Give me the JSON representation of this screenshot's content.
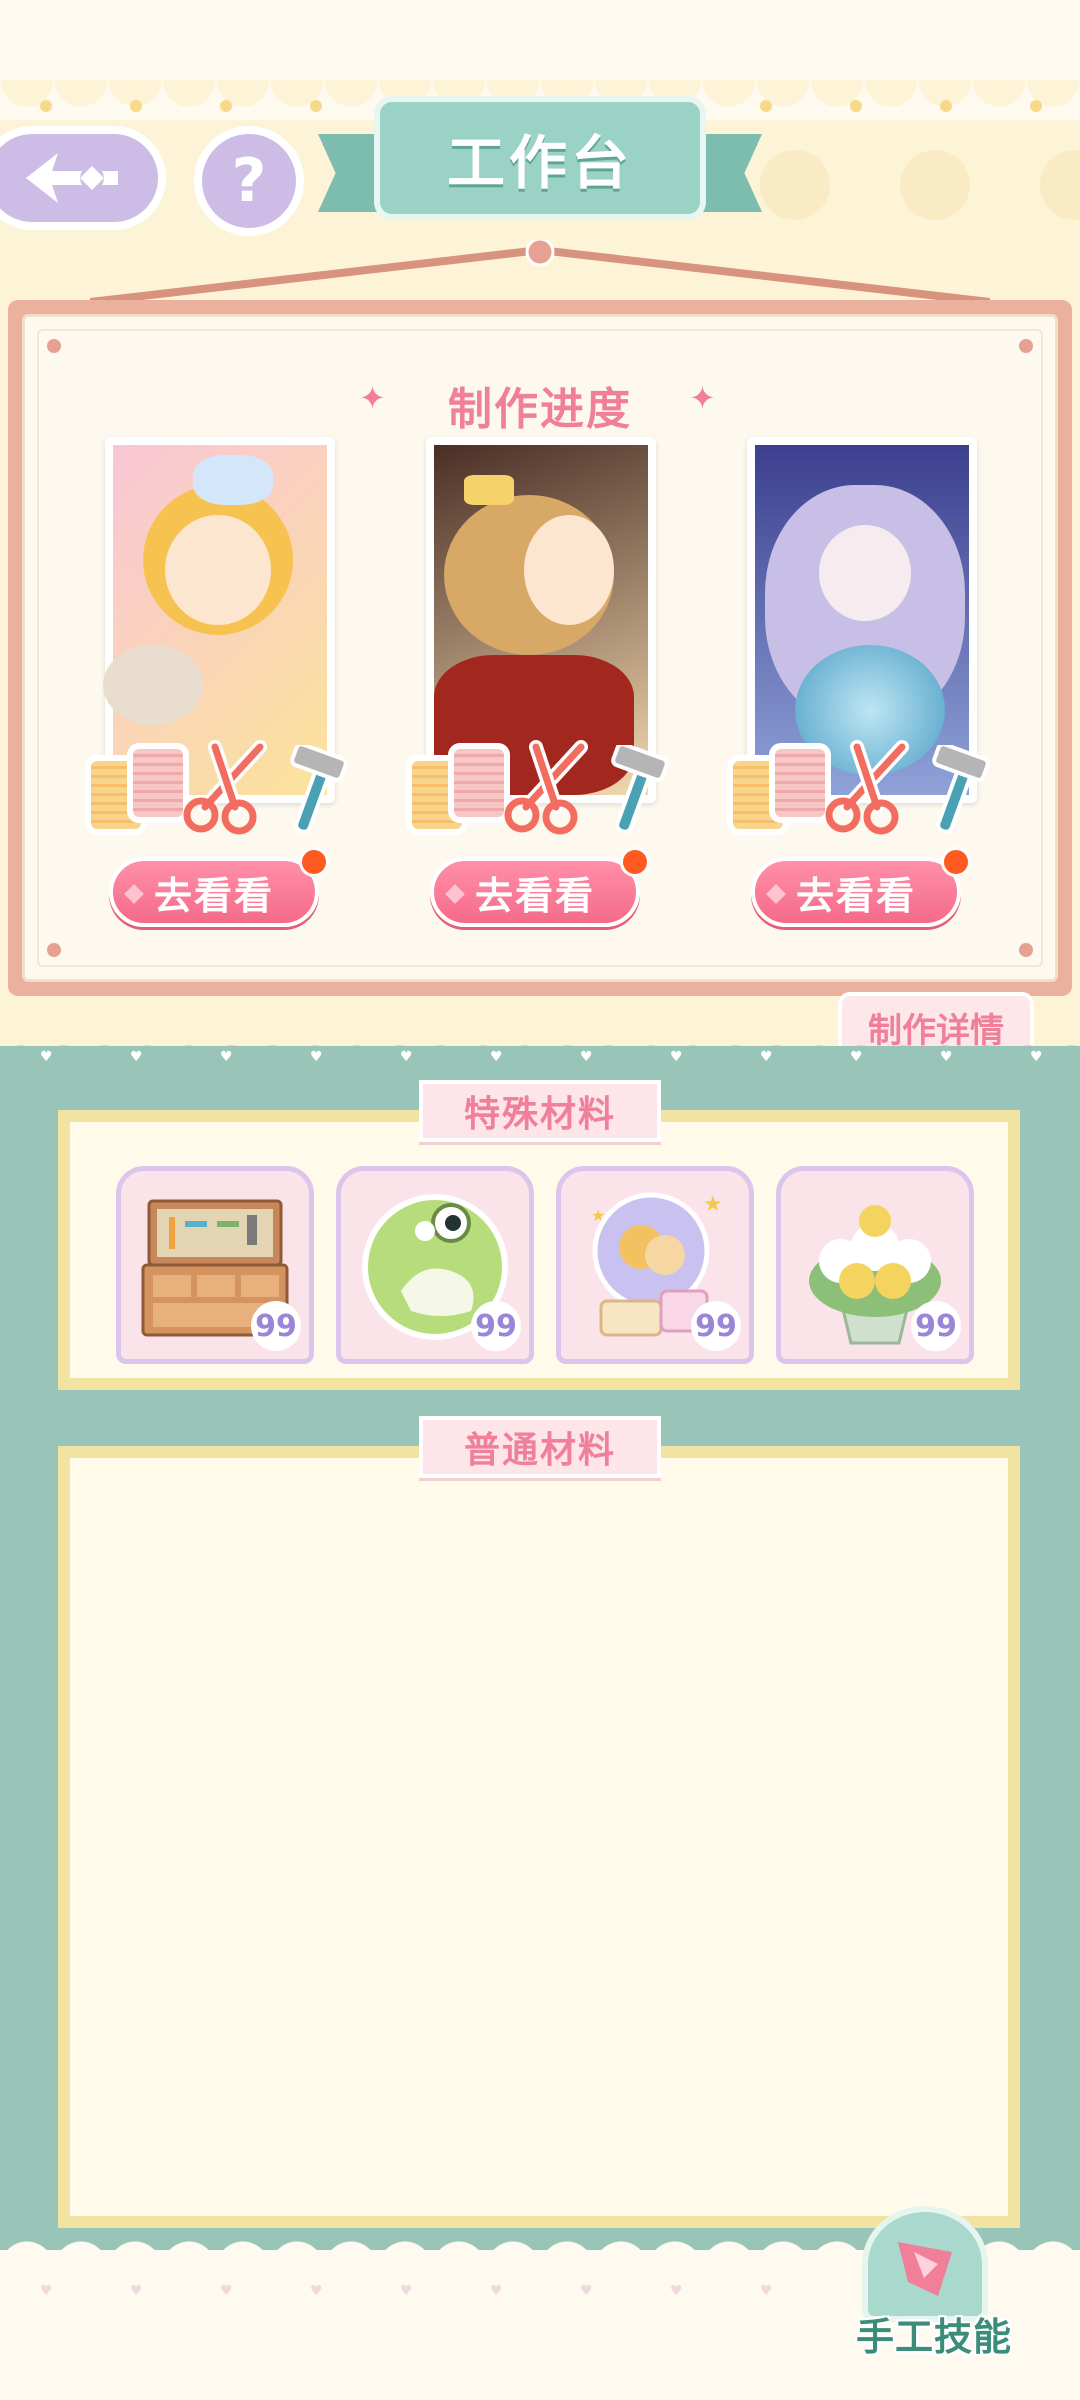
{
  "header": {
    "title": "工作台",
    "help_symbol": "?"
  },
  "progress": {
    "heading": "制作进度",
    "cards": [
      {
        "button_label": "去看看",
        "has_notification": true
      },
      {
        "button_label": "去看看",
        "has_notification": true
      },
      {
        "button_label": "去看看",
        "has_notification": true
      }
    ],
    "detail_tab": "制作详情"
  },
  "special_materials": {
    "label": "特殊材料",
    "items": [
      {
        "icon": "workbench-cabinet-icon",
        "count": "99"
      },
      {
        "icon": "green-frog-ball-icon",
        "count": "99"
      },
      {
        "icon": "snow-globe-icon",
        "count": "99"
      },
      {
        "icon": "flower-bouquet-icon",
        "count": "99"
      }
    ]
  },
  "normal_materials": {
    "label": "普通材料"
  },
  "footer": {
    "skill_label": "手工技能"
  },
  "colors": {
    "accent_pink": "#f07f9a",
    "mint": "#98c5b8",
    "cream": "#fdf3d6",
    "lavender": "#cdbde6"
  }
}
